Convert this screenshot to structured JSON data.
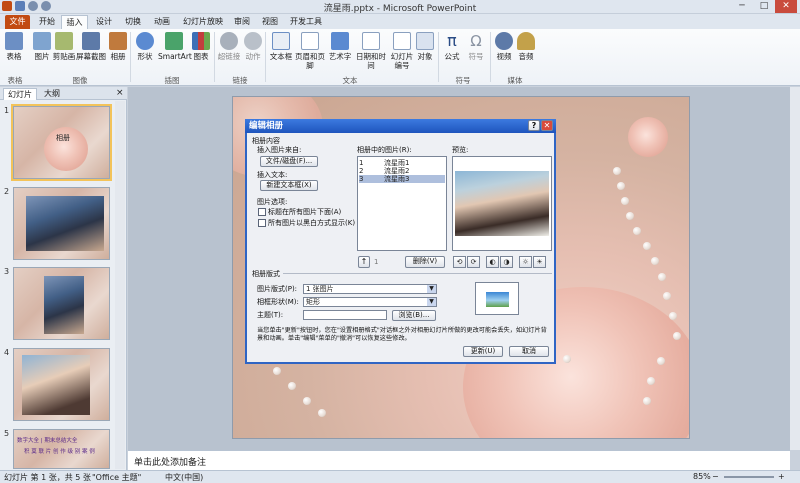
{
  "window": {
    "title": "流星雨.pptx - Microsoft PowerPoint",
    "min_glyph": "─",
    "max_glyph": "□",
    "close_glyph": "✕",
    "help_glyph": "?"
  },
  "tabs": [
    "文件",
    "开始",
    "插入",
    "设计",
    "切换",
    "动画",
    "幻灯片放映",
    "审阅",
    "视图",
    "开发工具"
  ],
  "active_tab": "插入",
  "ribbon": {
    "buttons": [
      "表格",
      "图片",
      "剪贴画",
      "屏幕截图",
      "相册",
      "形状",
      "SmartArt",
      "图表",
      "超链接",
      "动作",
      "文本框",
      "页眉和页脚",
      "艺术字",
      "日期和时间",
      "幻灯片编号",
      "对象",
      "公式",
      "符号",
      "视频",
      "音频"
    ],
    "groups": [
      "表格",
      "图像",
      "插图",
      "链接",
      "文本",
      "符号",
      "媒体"
    ],
    "icon_names": [
      "table-icon",
      "picture-icon",
      "clipart-icon",
      "screenshot-icon",
      "album-icon",
      "shapes-icon",
      "smartart-icon",
      "chart-icon",
      "hyperlink-icon",
      "action-icon",
      "textbox-icon",
      "header-footer-icon",
      "wordart-icon",
      "datetime-icon",
      "slide-number-icon",
      "object-icon",
      "equation-icon",
      "symbol-icon",
      "video-icon",
      "audio-icon"
    ]
  },
  "left_pane": {
    "tabs": [
      "幻灯片",
      "大纲"
    ],
    "close_glyph": "×",
    "thumbnails": [
      "1",
      "2",
      "3",
      "4",
      "5"
    ],
    "thumb1_text": "相册",
    "thumb5_text_line1": "数字大全 | 期末总结大全",
    "thumb5_text_line2": "积 莫 联 片 创 作 级 别 案 例"
  },
  "notes_placeholder": "单击此处添加备注",
  "status": {
    "slide": "幻灯片 第 1 张，共 5 张",
    "theme": "\"Office 主题\"",
    "lang": "中文(中国)",
    "zoom": "85%",
    "zoom_minus": "−",
    "zoom_plus": "+"
  },
  "dialog": {
    "title": "编辑相册",
    "section_content": "相册内容",
    "insert_from": "插入图片来自:",
    "file_disk_button": "文件/磁盘(F)...",
    "insert_text": "插入文本:",
    "new_textbox_button": "新建文本框(X)",
    "picture_options": "图片选项:",
    "captions_below": "标题在所有图片下面(A)",
    "all_black_white": "所有图片以黑白方式显示(K)",
    "pictures_in_album": "相册中的图片(R):",
    "pictures": [
      {
        "num": "1",
        "name": "流星雨1"
      },
      {
        "num": "2",
        "name": "流星雨2"
      },
      {
        "num": "3",
        "name": "流星雨3"
      }
    ],
    "selected_index": 2,
    "preview": "预览:",
    "move_up": "↑",
    "move_index": "1",
    "delete_button": "删除(V)",
    "section_layout": "相册版式",
    "picture_layout_label": "图片版式(P):",
    "picture_layout_value": "1 张图片",
    "frame_shape_label": "相框形状(M):",
    "frame_shape_value": "矩形",
    "theme_label": "主题(T):",
    "browse_button": "浏览(B)...",
    "note": "当您单击\"更新\"按钮时，您在\"设置相册格式\"对话框之外对相册幻灯片所做的更改可能会丢失，如幻灯片背景和动画。单击\"编辑\"菜单的\"撤消\"可以恢复这些修改。",
    "update_button": "更新(U)",
    "cancel_button": "取消"
  }
}
